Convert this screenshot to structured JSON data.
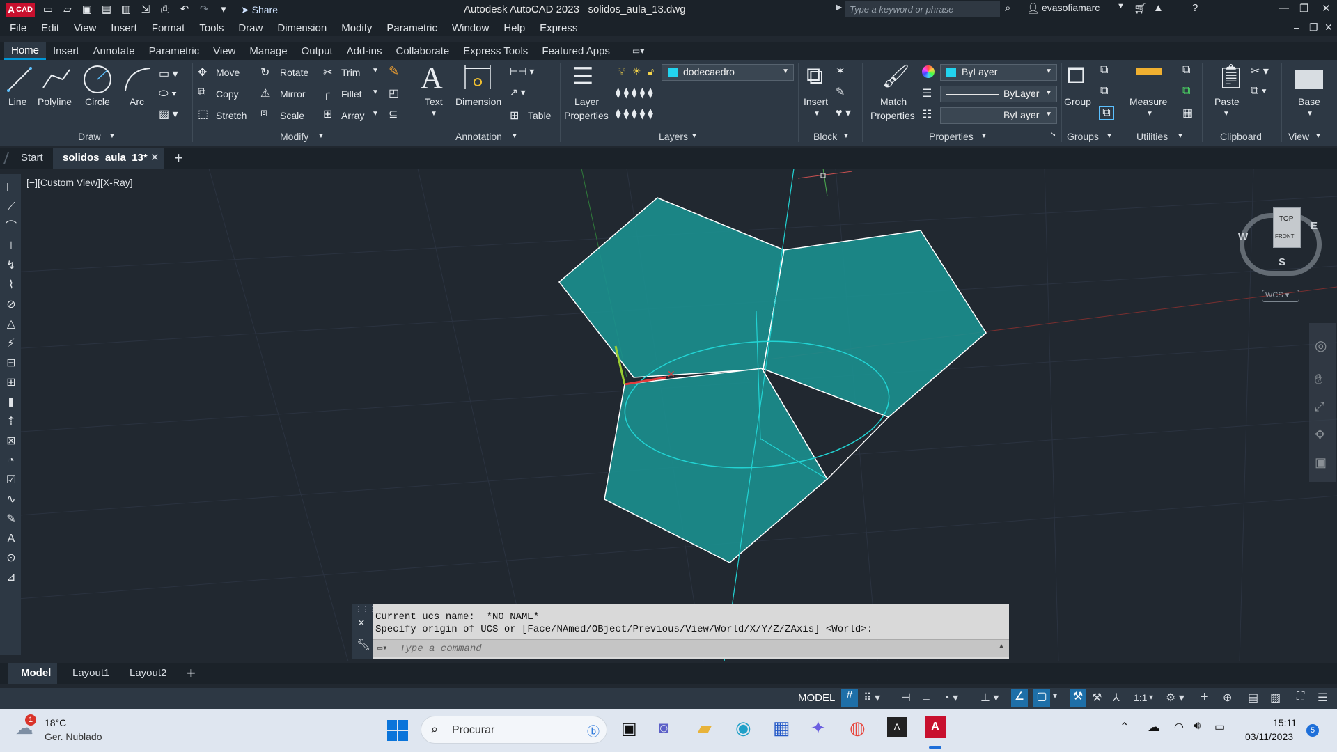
{
  "titlebar": {
    "app_badge": "CAD",
    "share_label": "Share",
    "title": "Autodesk AutoCAD 2023",
    "filename": "solidos_aula_13.dwg",
    "search_placeholder": "Type a keyword or phrase",
    "username": "evasofiamarc"
  },
  "menubar": [
    "File",
    "Edit",
    "View",
    "Insert",
    "Format",
    "Tools",
    "Draw",
    "Dimension",
    "Modify",
    "Parametric",
    "Window",
    "Help",
    "Express"
  ],
  "ribbon_tabs": [
    "Home",
    "Insert",
    "Annotate",
    "Parametric",
    "View",
    "Manage",
    "Output",
    "Add-ins",
    "Collaborate",
    "Express Tools",
    "Featured Apps"
  ],
  "ribbon": {
    "draw": {
      "title": "Draw",
      "line": "Line",
      "polyline": "Polyline",
      "circle": "Circle",
      "arc": "Arc"
    },
    "modify": {
      "title": "Modify",
      "move": "Move",
      "rotate": "Rotate",
      "trim": "Trim",
      "copy": "Copy",
      "mirror": "Mirror",
      "fillet": "Fillet",
      "stretch": "Stretch",
      "scale": "Scale",
      "array": "Array"
    },
    "annotation": {
      "title": "Annotation",
      "text": "Text",
      "dimension": "Dimension",
      "table": "Table"
    },
    "layers": {
      "title": "Layers",
      "layer_properties_1": "Layer",
      "layer_properties_2": "Properties",
      "current_layer": "dodecaedro"
    },
    "block": {
      "title": "Block",
      "insert": "Insert"
    },
    "properties": {
      "title": "Properties",
      "match_1": "Match",
      "match_2": "Properties",
      "color": "ByLayer",
      "lineweight": "ByLayer",
      "linetype": "ByLayer"
    },
    "groups": {
      "title": "Groups",
      "group": "Group"
    },
    "utilities": {
      "title": "Utilities",
      "measure": "Measure"
    },
    "clipboard": {
      "title": "Clipboard",
      "paste": "Paste"
    },
    "view": {
      "title": "View",
      "base": "Base"
    }
  },
  "file_tabs": {
    "start": "Start",
    "current": "solidos_aula_13*"
  },
  "viewport": {
    "label": "[−][Custom View][X-Ray]",
    "viewcube": {
      "top": "TOP",
      "front": "FRONT",
      "east": "E",
      "west": "W",
      "south": "S",
      "wcs": "WCS"
    }
  },
  "command": {
    "line1": "Current ucs name:  *NO NAME*",
    "line2": "Specify origin of UCS or [Face/NAmed/OBject/Previous/View/World/X/Y/Z/ZAxis] <World>:",
    "placeholder": "Type a command"
  },
  "layout_tabs": [
    "Model",
    "Layout1",
    "Layout2"
  ],
  "statusbar": {
    "model": "MODEL",
    "scale": "1:1"
  },
  "taskbar": {
    "weather_temp": "18°C",
    "weather_desc": "Ger. Nublado",
    "weather_badge": "1",
    "search": "Procurar",
    "time": "15:11",
    "date": "03/11/2023",
    "notif_count": "5"
  },
  "colors": {
    "accent": "#0096d6",
    "face": "#1b8f8f",
    "cyan": "#22d3d3",
    "brand": "#c8102e"
  }
}
